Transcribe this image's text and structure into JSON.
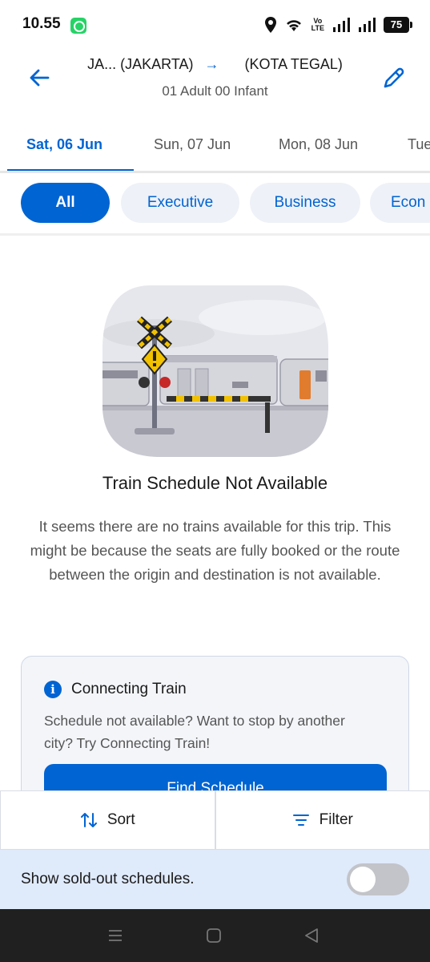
{
  "status_bar": {
    "time": "10.55",
    "volte_top": "Vo",
    "volte_bottom": "LTE",
    "battery": "75",
    "icons": [
      "whatsapp-icon",
      "location-icon",
      "wifi-icon",
      "signal-icon",
      "signal-icon",
      "battery-icon"
    ]
  },
  "header": {
    "origin": "JA... (JAKARTA)",
    "arrow": "→",
    "destination": "(KOTA TEGAL)",
    "passengers": "01 Adult 00 Infant",
    "back_icon": "arrow-left-icon",
    "edit_icon": "pencil-icon"
  },
  "date_tabs": [
    {
      "label": "Sat, 06 Jun",
      "active": true
    },
    {
      "label": "Sun, 07 Jun",
      "active": false
    },
    {
      "label": "Mon, 08 Jun",
      "active": false
    },
    {
      "label": "Tue",
      "active": false
    }
  ],
  "class_chips": [
    {
      "label": "All",
      "active": true
    },
    {
      "label": "Executive",
      "active": false
    },
    {
      "label": "Business",
      "active": false
    },
    {
      "label": "Econ",
      "active": false
    }
  ],
  "empty_state": {
    "title": "Train Schedule Not Available",
    "description": "It seems there are no trains available for this trip. This might be because the seats are fully booked or the route between the origin and destination is not available."
  },
  "connecting_card": {
    "title": "Connecting Train",
    "description": "Schedule not available? Want to stop by another city? Try Connecting Train!",
    "button": "Find Schedule"
  },
  "bottom_actions": {
    "sort": "Sort",
    "filter": "Filter"
  },
  "soldout_toggle": {
    "label": "Show sold-out schedules.",
    "on": false
  },
  "colors": {
    "accent": "#0064d2",
    "chip_bg": "#eef1f7",
    "soldout_bg": "#dfeafb",
    "navbar": "#202020"
  }
}
